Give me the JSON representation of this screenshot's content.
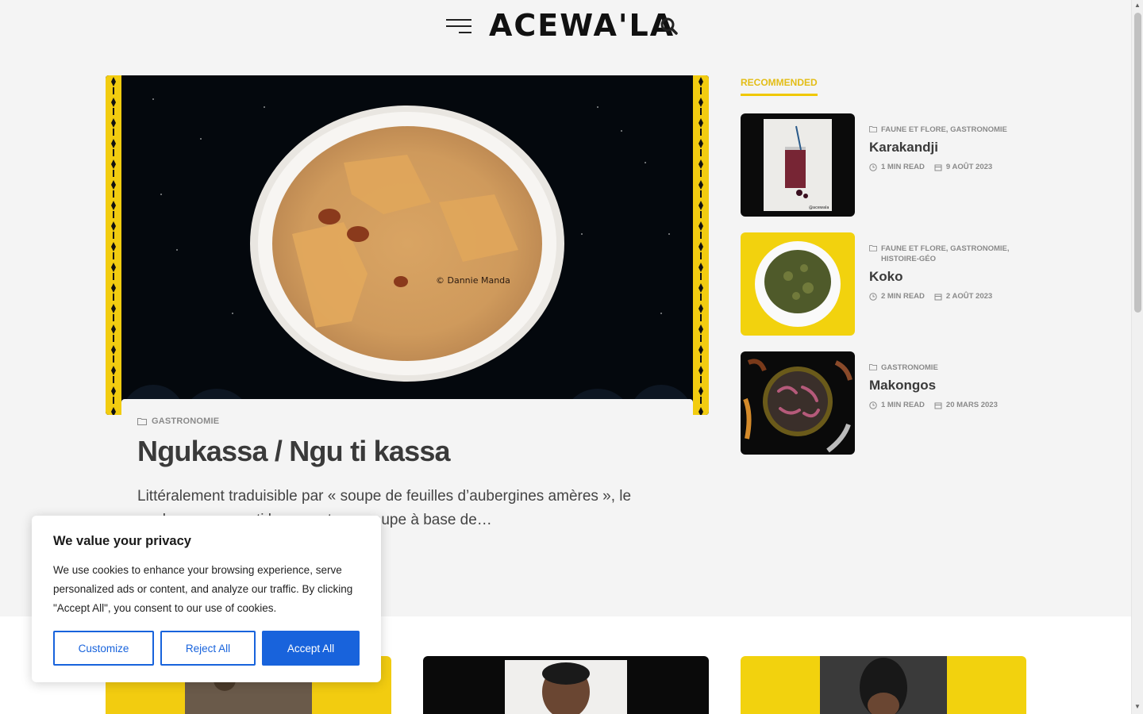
{
  "header": {
    "logo_text": "ACEWA'LA"
  },
  "featured": {
    "category": "GASTRONOMIE",
    "title": "Ngukassa / Ngu ti kassa",
    "excerpt": "Littéralement traduisible par « soupe de feuilles d’aubergines amères », le ngukassa ou ngu ti kassa est une soupe à base de…",
    "image_credit": "© Dannie Manda"
  },
  "recommended": {
    "heading": "RECOMMENDED",
    "items": [
      {
        "categories": "FAUNE ET FLORE, GASTRONOMIE",
        "title": "Karakandji",
        "read_time": "1 MIN READ",
        "date": "9 AOÛT 2023",
        "thumb_caption": "@acewala"
      },
      {
        "categories": "FAUNE ET FLORE, GASTRONOMIE, HISTOIRE-GÉO",
        "title": "Koko",
        "read_time": "2 MIN READ",
        "date": "2 AOÛT 2023"
      },
      {
        "categories": "GASTRONOMIE",
        "title": "Makongos",
        "read_time": "1 MIN READ",
        "date": "20 MARS 2023"
      }
    ]
  },
  "cookie": {
    "title": "We value your privacy",
    "text": "We use cookies to enhance your browsing experience, serve personalized ads or content, and analyze our traffic. By clicking \"Accept All\", you consent to our use of cookies.",
    "customize": "Customize",
    "reject": "Reject All",
    "accept": "Accept All"
  },
  "colors": {
    "accent_yellow": "#f0c800",
    "cookie_blue": "#1863dc",
    "page_bg": "#f4f4f4"
  }
}
